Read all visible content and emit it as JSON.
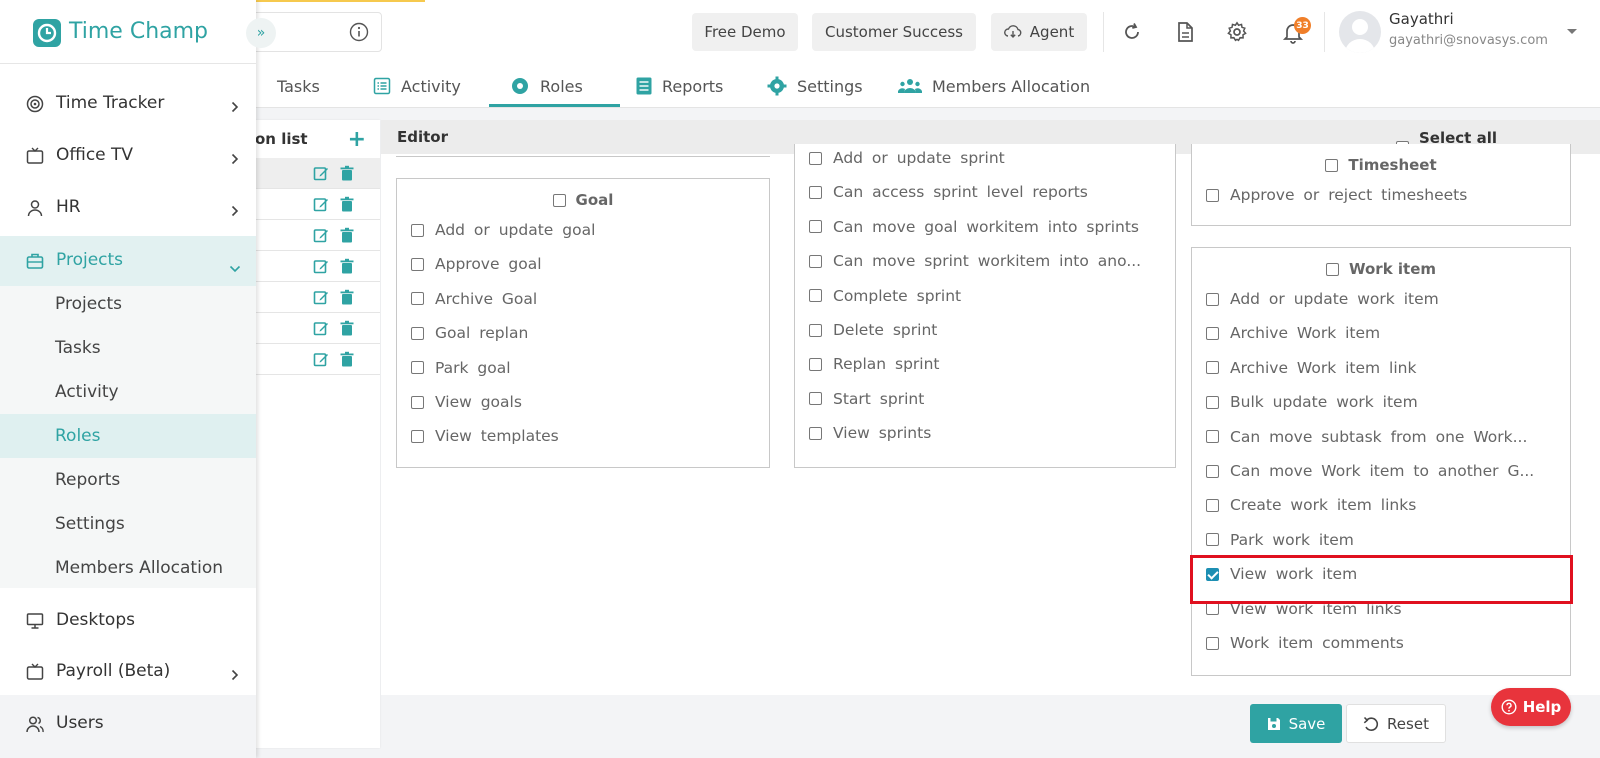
{
  "header": {
    "free_demo": "Free Demo",
    "customer_success": "Customer Success",
    "agent": "Agent",
    "notification_count": "33",
    "user_name": "Gayathri",
    "user_email": "gayathri@snovasys.com"
  },
  "brand": {
    "name": "Time Champ",
    "accent": "#2fa3a3"
  },
  "sidebar": {
    "items": [
      {
        "label": "Time Tracker",
        "icon": "time-tracker-icon"
      },
      {
        "label": "Office TV",
        "icon": "tv-icon"
      },
      {
        "label": "HR",
        "icon": "person-icon"
      },
      {
        "label": "Projects",
        "icon": "briefcase-icon"
      },
      {
        "label": "Desktops",
        "icon": "monitor-icon"
      },
      {
        "label": "Payroll (Beta)",
        "icon": "calendar-icon"
      },
      {
        "label": "Users",
        "icon": "users-icon"
      }
    ],
    "project_sub": [
      "Projects",
      "Tasks",
      "Activity",
      "Roles",
      "Reports",
      "Settings",
      "Members Allocation"
    ]
  },
  "tabs": [
    "Tasks",
    "Activity",
    "Roles",
    "Reports",
    "Settings",
    "Members Allocation"
  ],
  "rolelist": {
    "title": "on list"
  },
  "editor": {
    "title": "Editor",
    "select_all": "Select all permissions",
    "goal": {
      "title": "Goal",
      "items": [
        "Add or update goal",
        "Approve goal",
        "Archive Goal",
        "Goal replan",
        "Park goal",
        "View goals",
        "View templates"
      ]
    },
    "sprint": {
      "items": [
        "Add or update sprint",
        "Can access sprint level reports",
        "Can move goal workitem into sprints",
        "Can move sprint workitem into ano...",
        "Complete sprint",
        "Delete sprint",
        "Replan sprint",
        "Start sprint",
        "View sprints"
      ]
    },
    "timesheet": {
      "title": "Timesheet",
      "items": [
        "Approve or reject timesheets"
      ]
    },
    "workitem": {
      "title": "Work item",
      "items": [
        "Add or update work item",
        "Archive Work item",
        "Archive Work item link",
        "Bulk update work item",
        "Can move subtask from one Work...",
        "Can move Work item to another G...",
        "Create work item links",
        "Park work item",
        "View work item",
        "View work item links",
        "Work item comments"
      ]
    }
  },
  "footer": {
    "save": "Save",
    "reset": "Reset",
    "help": "Help"
  }
}
